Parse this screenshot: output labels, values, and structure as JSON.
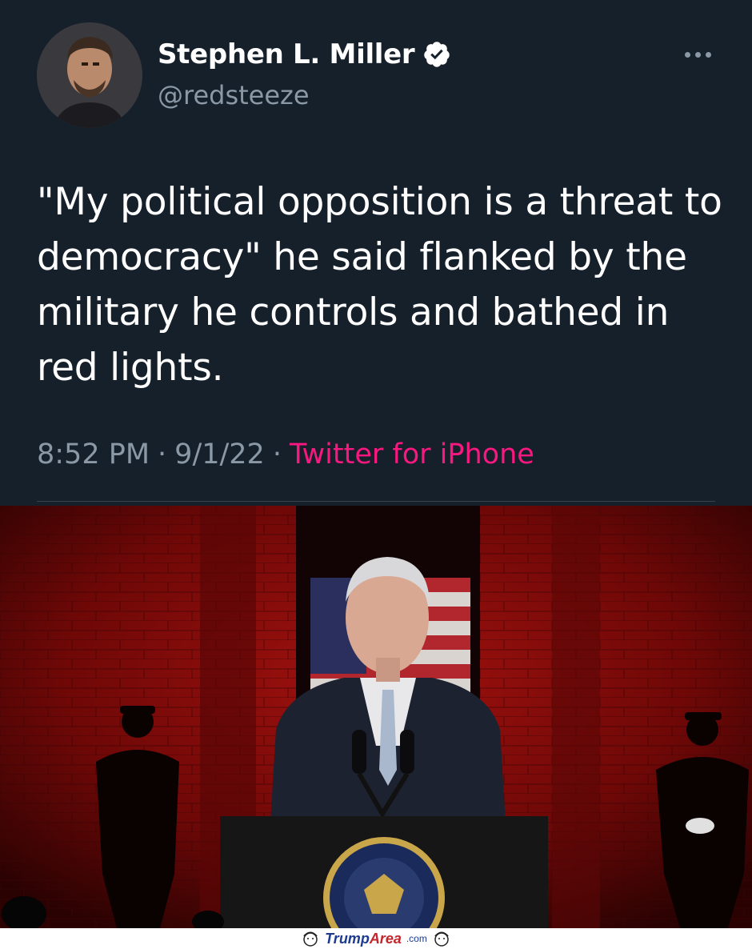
{
  "tweet": {
    "display_name": "Stephen L. Miller",
    "handle": "@redsteeze",
    "verified_icon": "verified-badge-icon",
    "more_icon": "more-options-icon",
    "text": "\"My political opposition is a threat to democracy\" he said flanked by the military he controls and bathed in red lights.",
    "time": "8:52 PM",
    "date": "9/1/22",
    "separator": "·",
    "source": "Twitter for iPhone"
  },
  "watermark": {
    "brand_part1": "Trump",
    "brand_part2": "Area",
    "brand_suffix": ".com"
  },
  "colors": {
    "background": "#15202b",
    "source_link": "#f91880",
    "secondary_text": "#8b98a5"
  }
}
